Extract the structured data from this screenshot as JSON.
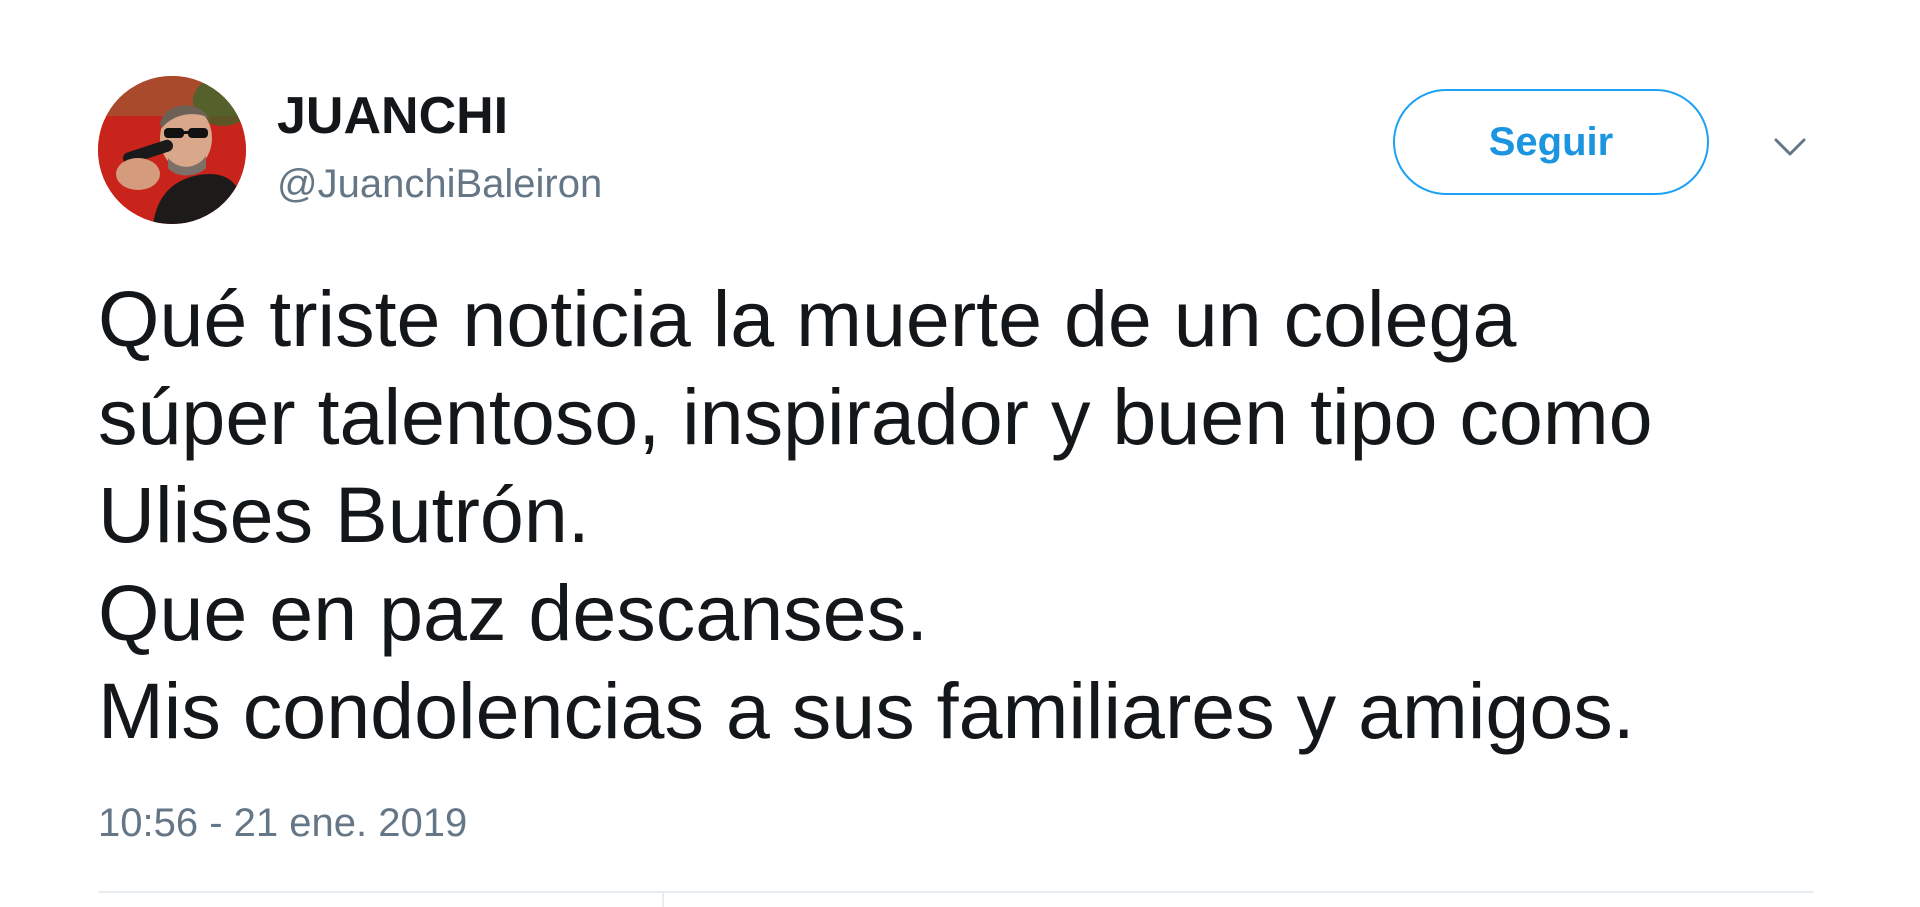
{
  "user": {
    "display_name": "JUANCHI",
    "handle": "@JuanchiBaleiron"
  },
  "follow_button": {
    "label": "Seguir"
  },
  "tweet": {
    "lines": [
      "Qué triste noticia la muerte de un colega",
      "súper talentoso, inspirador y buen tipo como",
      "Ulises Butrón.",
      "Que en paz descanses.",
      "Mis condolencias a sus familiares y amigos."
    ],
    "timestamp": "10:56 - 21 ene. 2019"
  },
  "icons": {
    "menu": "chevron-down-icon",
    "avatar": "profile-photo"
  },
  "colors": {
    "accent": "#1da1f2",
    "accent_text": "#1b95e0",
    "secondary_text": "#657786",
    "primary_text": "#14171a",
    "divider": "#e6ecf0"
  }
}
